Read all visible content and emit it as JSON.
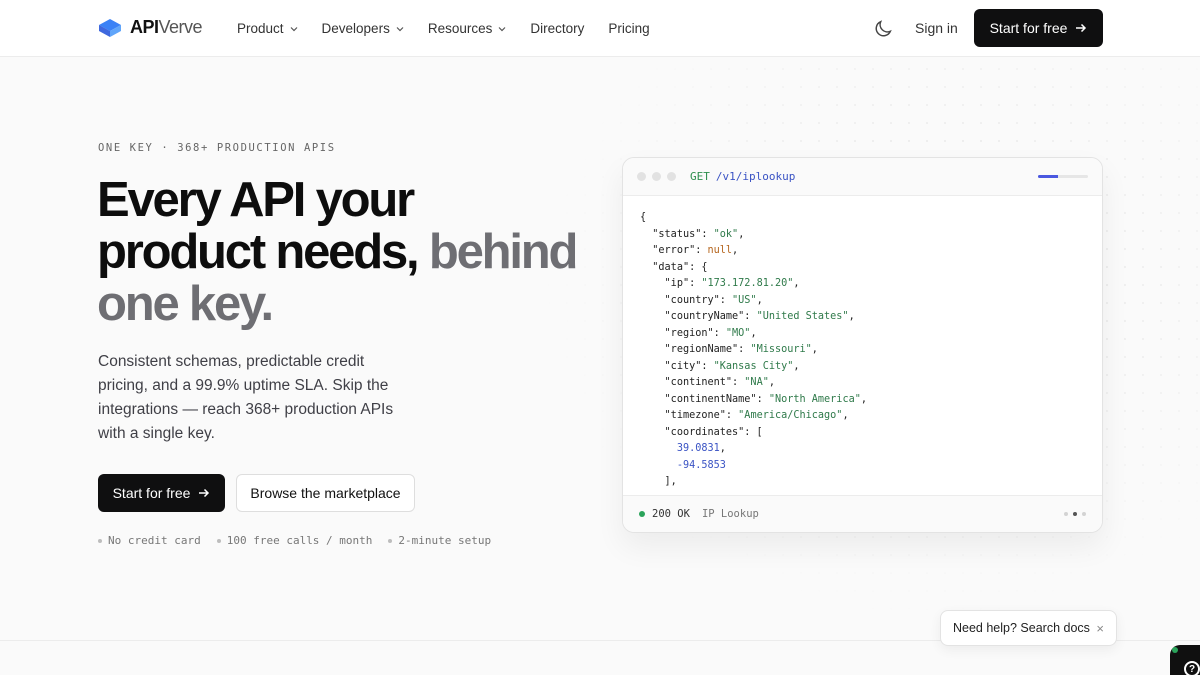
{
  "header": {
    "logo": {
      "bold": "API",
      "rest": "Verve",
      "icon": "cube-logo-icon"
    },
    "nav": [
      {
        "label": "Product",
        "dropdown": true
      },
      {
        "label": "Developers",
        "dropdown": true
      },
      {
        "label": "Resources",
        "dropdown": true
      },
      {
        "label": "Directory",
        "dropdown": false
      },
      {
        "label": "Pricing",
        "dropdown": false
      }
    ],
    "theme_icon": "moon-icon",
    "signin": "Sign in",
    "cta": "Start for free",
    "cta_icon": "arrow-right-icon"
  },
  "hero": {
    "eyebrow": "ONE KEY · 368+ PRODUCTION APIS",
    "headline_main": "Every API your product needs,",
    "headline_muted": "behind one key.",
    "lead": "Consistent schemas, predictable credit pricing, and a 99.9% uptime SLA. Skip the integrations — reach 368+ production APIs with a single key.",
    "primary_button": "Start for free",
    "secondary_button": "Browse the marketplace",
    "perks": [
      "No credit card",
      "100 free calls / month",
      "2-minute setup"
    ]
  },
  "code_card": {
    "method": "GET",
    "path": "/v1/iplookup",
    "progress": 0.4,
    "response": {
      "status": "ok",
      "error": "null",
      "ip": "173.172.81.20",
      "country": "US",
      "countryName": "United States",
      "region": "MO",
      "regionName": "Missouri",
      "city": "Kansas City",
      "continent": "NA",
      "continentName": "North America",
      "timezone": "America/Chicago",
      "coordinates": [
        "39.0831",
        "-94.5853"
      ]
    },
    "status_code": "200 OK",
    "api_name": "IP Lookup",
    "pager_active": 2,
    "pager_count": 3
  },
  "help": {
    "label": "Need help? Search docs",
    "close": "×"
  },
  "colors": {
    "primary": "#0f0f10",
    "accent_blue": "#4a58e0",
    "string_green": "#2f7a4a",
    "status_green": "#2aa35a"
  }
}
